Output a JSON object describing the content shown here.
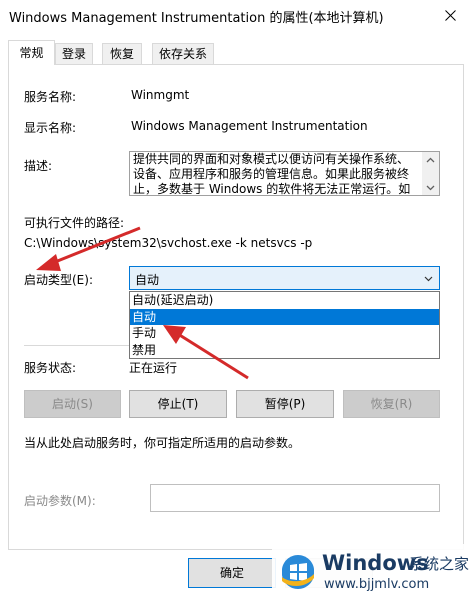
{
  "window": {
    "title": "Windows Management Instrumentation 的属性(本地计算机)",
    "close_glyph": "✕"
  },
  "tabs": [
    {
      "label": "常规",
      "active": true
    },
    {
      "label": "登录",
      "active": false
    },
    {
      "label": "恢复",
      "active": false
    },
    {
      "label": "依存关系",
      "active": false
    }
  ],
  "general": {
    "service_name_label": "服务名称:",
    "service_name_value": "Winmgmt",
    "display_name_label": "显示名称:",
    "display_name_value": "Windows Management Instrumentation",
    "description_label": "描述:",
    "description_value": "提供共同的界面和对象模式以便访问有关操作系统、设备、应用程序和服务的管理信息。如果此服务被终止，多数基于 Windows 的软件将无法正常运行。如果此",
    "path_label": "可执行文件的路径:",
    "path_value": "C:\\Windows\\system32\\svchost.exe -k netsvcs -p",
    "startup_type_label": "启动类型(E):",
    "startup_type_value": "自动",
    "startup_options": [
      "自动(延迟启动)",
      "自动",
      "手动",
      "禁用"
    ],
    "startup_selected_index": 1,
    "status_label": "服务状态:",
    "status_value": "正在运行",
    "buttons": {
      "start": "启动(S)",
      "stop": "停止(T)",
      "pause": "暂停(P)",
      "resume": "恢复(R)"
    },
    "hint": "当从此处启动服务时，你可指定所适用的启动参数。",
    "params_label": "启动参数(M):",
    "params_value": ""
  },
  "footer": {
    "ok": "确定"
  },
  "watermark": {
    "brand": "Windows",
    "brand2": "系统之家",
    "url": "www.bjjmlv.com"
  },
  "colors": {
    "accent": "#0078d7",
    "annotation_arrow": "#d42a2a"
  },
  "icons": {
    "close": "close-icon",
    "dropdown": "chevron-down-icon",
    "scroll_up": "scroll-up-icon",
    "scroll_down": "scroll-down-icon",
    "logo": "windows-logo-icon"
  }
}
